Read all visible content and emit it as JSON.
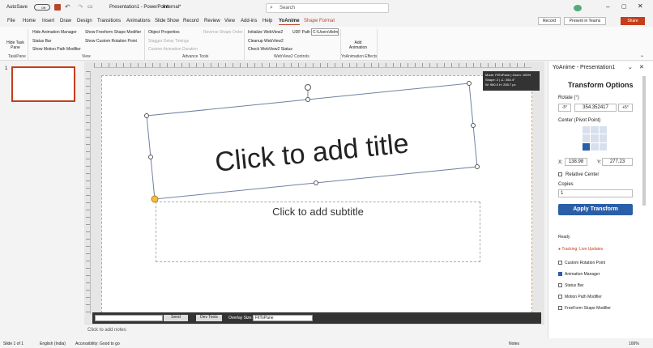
{
  "titlebar": {
    "autosave": "AutoSave",
    "toggle": "Off",
    "doc": "Presentation1 - PowerPoint",
    "label": "Internal*",
    "search": "Search"
  },
  "menu": {
    "items": [
      "File",
      "Home",
      "Insert",
      "Draw",
      "Design",
      "Transitions",
      "Animations",
      "Slide Show",
      "Record",
      "Review",
      "View",
      "Add-ins",
      "Help",
      "YoAnime",
      "Shape Format"
    ],
    "record": "Record",
    "teams": "Present in Teams",
    "share": "Share"
  },
  "ribbon": {
    "hide_task_pane": "Hide Task Pane",
    "taskpane_group": "TaskPane",
    "view": [
      "Hide Animation Manager",
      "Status Bar",
      "Show Motion Path Modifier"
    ],
    "view2": [
      "Show Freeform Shape Modifier",
      "Show Custom Rotation Point"
    ],
    "view_group": "View",
    "adv": [
      "Object Properties",
      "Stagger Delay Timings",
      "Custom Animation Duration"
    ],
    "reverse": "Reverse Shape Order",
    "adv_group": "Advance Tools",
    "wv": [
      "Initialize WebView2",
      "Cleanup WebView2",
      "Check WebView2 Status"
    ],
    "udf_label": "UDF Path",
    "udf_value": "C:\\Users\\Adm",
    "wv_group": "WebView2 Controls",
    "add_anim": "Add Animation",
    "yo_group": "YoAnimation Effects"
  },
  "slide": {
    "number": "1",
    "title": "Click to add title",
    "subtitle": "Click to add subtitle",
    "notes": "Click to add notes"
  },
  "tooltip": {
    "line1": "Mode: FitToPane | Zoom: 100%",
    "line2": "Shape: 2 | ∠: 354.4°",
    "line3": "W: 960.0  H: 255.7 px"
  },
  "devbar": {
    "send": "Send",
    "devtools": "Dev Tools",
    "overlay_label": "Overlay Size:",
    "overlay_value": "FitToPane"
  },
  "pane": {
    "title": "YoAnime - Presentation1",
    "heading": "Transform Options",
    "rotate_label": "Rotate (°)",
    "minus": "-5°",
    "rotate_value": "354.352417",
    "plus": "+5°",
    "center_label": "Center (Pivot Point)",
    "x_label": "X:",
    "x_value": "138.98",
    "y_label": "Y:",
    "y_value": "277.23",
    "relative": "Relative Center",
    "copies_label": "Copies",
    "copies_value": "1",
    "apply": "Apply Transform",
    "ready": "Ready",
    "tracking": "● Tracking: Live Updates",
    "checks": [
      {
        "label": "Custom Rotation Point",
        "checked": false
      },
      {
        "label": "Animation Manager",
        "checked": true
      },
      {
        "label": "Status Bar",
        "checked": false
      },
      {
        "label": "Motion Path Modifier",
        "checked": false
      },
      {
        "label": "FreeForm Shape Modifier",
        "checked": false
      }
    ]
  },
  "status": {
    "slide": "Slide 1 of 1",
    "lang": "English (India)",
    "access": "Accessibility: Good to go",
    "notes": "Notes",
    "zoom": "100%"
  }
}
